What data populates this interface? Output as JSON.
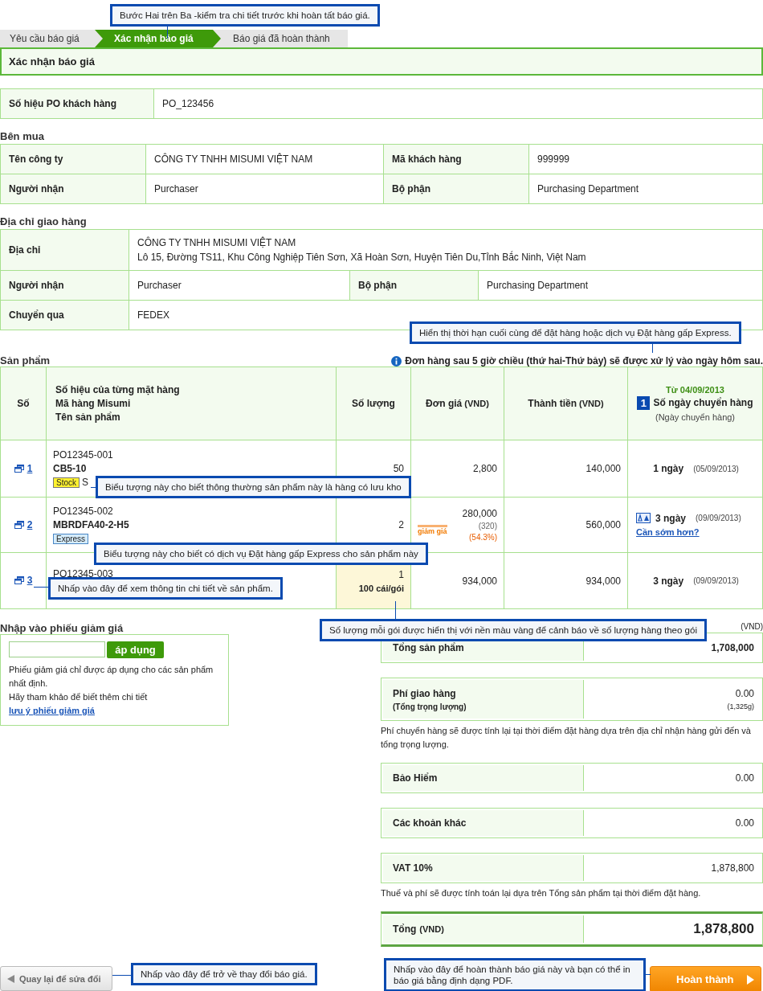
{
  "steps": [
    {
      "label": "Yêu cầu báo giá",
      "selected": false
    },
    {
      "label": "Xác nhận báo giá",
      "selected": true
    },
    {
      "label": "Báo giá đã hoàn thành",
      "selected": false
    }
  ],
  "page_title": "Xác nhận báo giá",
  "po": {
    "label": "Số hiệu PO khách hàng",
    "value": "PO_123456"
  },
  "buyer": {
    "title": "Bên mua",
    "rows": [
      {
        "label": "Tên công ty",
        "value": "CÔNG TY TNHH MISUMI VIỆT NAM",
        "label2": "Mã khách hàng",
        "value2": "999999"
      },
      {
        "label": "Người nhận",
        "value": "Purchaser",
        "label2": "Bộ phận",
        "value2": "Purchasing Department"
      }
    ]
  },
  "shipping": {
    "title": "Địa chỉ giao hàng",
    "rows": [
      {
        "kind": "address",
        "label": "Địa chỉ",
        "lines": [
          "CÔNG TY TNHH MISUMI VIỆT NAM",
          "Lô 15, Đường TS11, Khu Công Nghiệp Tiên Sơn, Xã Hoàn Sơn, Huyện Tiên Du,Tỉnh Bắc Ninh, Việt Nam"
        ]
      },
      {
        "kind": "pair",
        "label": "Người nhận",
        "value": "Purchaser",
        "label2": "Bộ phận",
        "value2": "Purchasing Department"
      },
      {
        "kind": "single",
        "label": "Chuyển qua",
        "value": "FEDEX"
      }
    ]
  },
  "products": {
    "title": "Sản phẩm",
    "note": "Đơn hàng sau 5 giờ chiều (thứ hai-Thứ bảy) sẽ được xử lý vào ngày hôm sau.",
    "columns": [
      {
        "lines": [
          "Số"
        ]
      },
      {
        "lines": [
          "Số hiệu của từng mặt hàng",
          "Mã hàng Misumi",
          "Tên sản phẩm"
        ]
      },
      {
        "lines": [
          "Số lượng"
        ]
      },
      {
        "lines": [
          "Đơn giá"
        ],
        "unit": "(VND)"
      },
      {
        "lines": [
          "Thành tiền"
        ],
        "unit": "(VND)"
      },
      {
        "from": "Từ 04/09/2013",
        "marker": "1",
        "lines": [
          "Số ngày chuyển hàng"
        ],
        "sub": "(Ngày chuyển hàng)"
      }
    ],
    "rows": [
      {
        "no": "1",
        "po": "PO12345-001",
        "code": "CB5-10",
        "badge": {
          "kind": "stock",
          "label": "Stock"
        },
        "name": "S",
        "qty": "50",
        "qty_highlight": false,
        "price": "2,800",
        "total": "140,000",
        "express": false,
        "days": "1 ngày",
        "date": "(05/09/2013)"
      },
      {
        "no": "2",
        "po": "PO12345-002",
        "code": "MBRDFA40-2-H5",
        "badge": {
          "kind": "express",
          "label": "Express"
        },
        "qty": "2",
        "qty_highlight": false,
        "price": "280,000",
        "discount": {
          "label": "giảm giá",
          "original": "(320)",
          "percent": "(54.3%)"
        },
        "total": "560,000",
        "express": true,
        "days": "3 ngày",
        "date": "(09/09/2013)",
        "faster": "Cần sớm hơn?"
      },
      {
        "no": "3",
        "po": "PO12345-003",
        "qty": "1",
        "pack": "100 cái/gói",
        "qty_highlight": true,
        "price": "934,000",
        "total": "934,000",
        "express": false,
        "days": "3 ngày",
        "date": "(09/09/2013)"
      }
    ]
  },
  "coupon": {
    "title": "Nhập vào phiếu giảm giá",
    "button": "áp dụng",
    "text1": "Phiếu giảm giá chỉ được áp dụng cho các sản phẩm nhất định.",
    "text2": "Hãy tham khảo để biết thêm chi tiết ",
    "link": "lưu ý phiếu giảm giá"
  },
  "summary": {
    "currency": "(VND)",
    "items": [
      {
        "kind": "row",
        "label": "Tổng sản phẩm",
        "value": "1,708,000",
        "bold": true
      },
      {
        "kind": "row",
        "label": "Phí giao hàng",
        "sub": "(Tổng trọng lượng)",
        "value": "0.00",
        "value_sub": "(1,325g)",
        "bold": false
      },
      {
        "kind": "note",
        "text": "Phí chuyển hàng sẽ được tính lại tại thời điểm đặt hàng dựa trên địa chỉ nhận hàng gửi đến và tổng trọng lượng."
      },
      {
        "kind": "row",
        "label": "Bảo Hiểm",
        "value": "0.00",
        "bold": false
      },
      {
        "kind": "row",
        "label": "Các khoản khác",
        "value": "0.00",
        "bold": false
      },
      {
        "kind": "row",
        "label": "VAT 10%",
        "value": "1,878,800",
        "bold": false
      },
      {
        "kind": "note",
        "text": "Thuế và phí sẽ được tính toán lại dựa trên Tổng sản phẩm tại thời điểm đặt hàng."
      },
      {
        "kind": "total",
        "label": "Tổng",
        "unit": "(VND)",
        "value": "1,878,800"
      }
    ]
  },
  "back_button": "Quay lại để sửa đổi",
  "finish_button": "Hoàn thành",
  "callouts": [
    "Bước Hai trên Ba -kiểm tra chi tiết trước khi hoàn tất báo giá.",
    "Hiển thị thời hạn cuối cùng để đặt hàng hoặc dịch vụ Đặt hàng gấp Express.",
    "Biểu tượng này cho biết thông thường sản phẩm này là hàng có lưu kho",
    "Biểu tượng này cho biết có dịch vụ Đặt hàng gấp Express cho sản phẩm này",
    "Nhấp vào đây để xem thông tin chi tiết về sản phẩm.",
    "Số lượng mỗi gói được hiển thị với nền màu vàng để cảnh báo về số lượng hàng theo gói",
    "Nhấp vào đây để trở về thay đổi báo giá.",
    "Nhấp vào đây để hoàn thành báo giá này và bạn có thể in báo giá bằng định dạng  PDF."
  ]
}
